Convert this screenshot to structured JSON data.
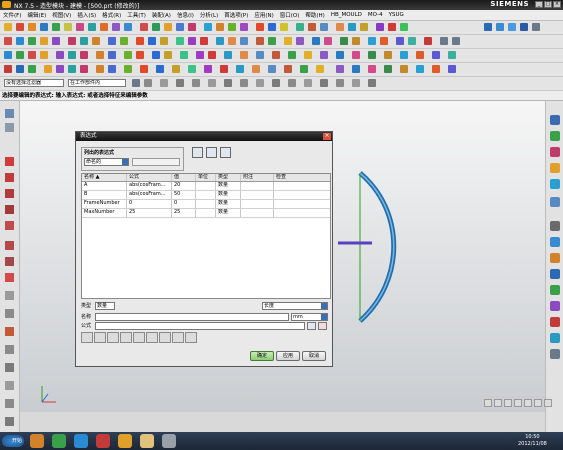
{
  "window": {
    "title": "NX 7.5 - 造型模块 - 建模 - [500.prt (修改的)]",
    "brand": "SIEMENS",
    "controls": [
      "_",
      "□",
      "×"
    ]
  },
  "menu": [
    "文件(F)",
    "编辑(E)",
    "视图(V)",
    "插入(S)",
    "格式(R)",
    "工具(T)",
    "装配(A)",
    "信息(I)",
    "分析(L)",
    "首选项(P)",
    "应用(N)",
    "窗口(O)",
    "帮助(H)",
    "HB_MOULD",
    "MO-4",
    "YSUG"
  ],
  "selection_bar": {
    "filter": "没有选择过滤器",
    "scope": "在工作部件内"
  },
  "cue_line": "选择要编辑的表达式: 输入表达式: 或者选择特征来编辑参数",
  "dialog": {
    "title": "表达式",
    "group_label": "列出的表达式",
    "list_filter": "命名的",
    "columns": [
      "名称 ▲",
      "公式",
      "值",
      "单位",
      "类型",
      "附注",
      "检查"
    ],
    "rows": [
      {
        "name": "A",
        "formula": "abs(cosFram...",
        "value": "20",
        "unit": "",
        "type": "数量",
        "note": "",
        "check": ""
      },
      {
        "name": "B",
        "formula": "abs(cosFram...",
        "value": "50",
        "unit": "",
        "type": "数量",
        "note": "",
        "check": ""
      },
      {
        "name": "FrameNumber",
        "formula": "0",
        "value": "0",
        "unit": "",
        "type": "数量",
        "note": "",
        "check": ""
      },
      {
        "name": "MaxNumber",
        "formula": "25",
        "value": "25",
        "unit": "",
        "type": "数量",
        "note": "",
        "check": ""
      }
    ],
    "type_label": "类型",
    "type_value": "数量",
    "dimension_value": "长度",
    "name_label": "名称",
    "name_value": "",
    "unit_value": "mm",
    "formula_label": "公式",
    "formula_value": "",
    "buttons": {
      "ok": "确定",
      "apply": "应用",
      "cancel": "取消"
    }
  },
  "taskbar": {
    "start": "开始",
    "time": "10:50",
    "date": "2012/11/08"
  },
  "colors": {
    "arc": "#1f6fb0",
    "axis_green": "#2aa02a",
    "axis_purple": "#5a3fc0",
    "dialog_title": "#1e1e1e"
  }
}
